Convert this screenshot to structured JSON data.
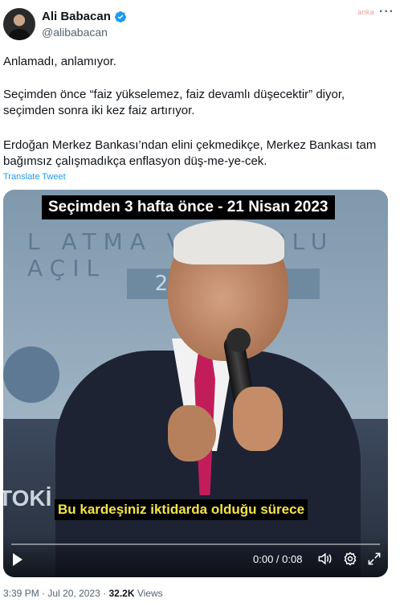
{
  "author": {
    "name": "Ali Babacan",
    "handle": "@alibabacan",
    "watermark": "anka",
    "more_label": "···"
  },
  "tweet": {
    "line1": "Anlamadı, anlamıyor.",
    "line2": "Seçimden önce “faiz yükselemez, faiz devamlı düşecektir” diyor, seçimden sonra iki kez faiz artırıyor.",
    "line3": "Erdoğan Merkez Bankası’ndan elini çekmedikçe, Merkez Bankası tam bağımsız çalışmadıkça enflasyon düş-me-ye-cek.",
    "translate_label": "Translate Tweet"
  },
  "video": {
    "caption_top": "Seçimden 3 hafta önce - 21 Nisan 2023",
    "caption_bottom": "Bu kardeşiniz iktidarda olduğu sürece",
    "banner_text": "L ATMA VE TOPLU AÇIL",
    "banner_date": "21 NİSAN 2023",
    "banner_left": "TOKİ",
    "time": "0:00 / 0:08",
    "progress_fraction": 0.0
  },
  "meta": {
    "time": "3:39 PM",
    "date": "Jul 20, 2023",
    "views_count": "32.2K",
    "views_label": "Views",
    "separator": "·"
  },
  "colors": {
    "link": "#1d9bf0",
    "verified": "#1d9bf0",
    "caption_yellow": "#f4e34a"
  }
}
